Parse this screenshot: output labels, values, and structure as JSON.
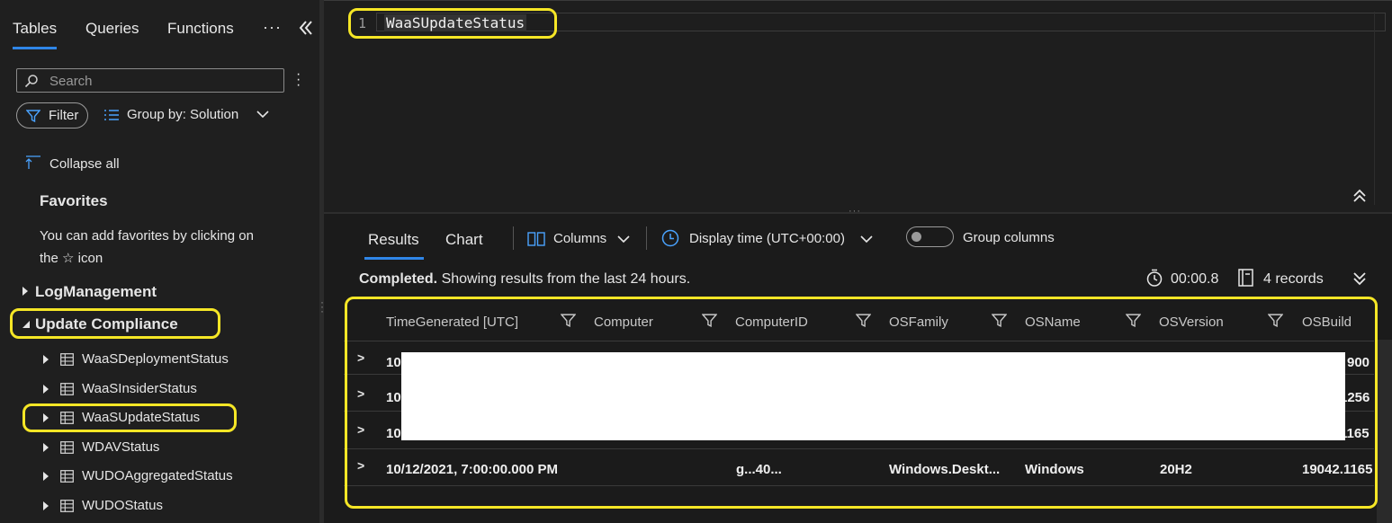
{
  "left_panel": {
    "tabs": [
      "Tables",
      "Queries",
      "Functions"
    ],
    "search_placeholder": "Search",
    "filter_label": "Filter",
    "group_by_label": "Group by: Solution",
    "collapse_all_label": "Collapse all",
    "favorites_title": "Favorites",
    "favorites_hint_line1": "You can add favorites by clicking on",
    "favorites_hint_line2_pre": "the",
    "favorites_hint_line2_post": "icon",
    "groups": [
      "LogManagement",
      "Update Compliance"
    ],
    "tables": [
      "WaaSDeploymentStatus",
      "WaaSInsiderStatus",
      "WaaSUpdateStatus",
      "WDAVStatus",
      "WUDOAggregatedStatus",
      "WUDOStatus"
    ]
  },
  "editor": {
    "line_number": "1",
    "query": "WaaSUpdateStatus"
  },
  "results": {
    "tabs": [
      "Results",
      "Chart"
    ],
    "columns_label": "Columns",
    "display_time_label": "Display time (UTC+00:00)",
    "group_columns_label": "Group columns",
    "status_bold": "Completed.",
    "status_text": "Showing results from the last 24 hours.",
    "duration": "00:00.8",
    "records": "4 records",
    "headers": [
      "TimeGenerated [UTC]",
      "Computer",
      "ComputerID",
      "OSFamily",
      "OSName",
      "OSVersion",
      "OSBuild"
    ],
    "partial_rows": [
      {
        "start": "10",
        "end": "900"
      },
      {
        "start": "10",
        "end": "1256"
      },
      {
        "start": "10",
        "end": "1165"
      }
    ],
    "last_row": {
      "time": "10/12/2021, 7:00:00.000 PM",
      "computer_id": "g...40...",
      "os_family": "Windows.Deskt...",
      "os_name": "Windows",
      "os_version": "20H2",
      "os_build": "19042.1165"
    }
  },
  "colors": {
    "accent": "#2f86e8",
    "highlight": "#f5e626",
    "background": "#1b1b1b"
  }
}
